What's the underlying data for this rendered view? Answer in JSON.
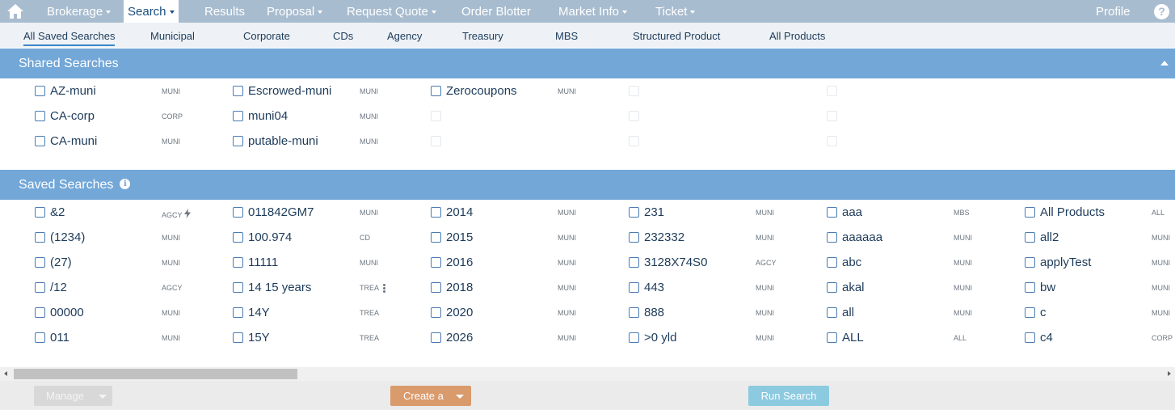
{
  "nav": {
    "items": [
      {
        "label": "Brokerage",
        "dropdown": true
      },
      {
        "label": "Search",
        "dropdown": true,
        "active": true
      },
      {
        "label": "Results",
        "dropdown": false
      },
      {
        "label": "Proposal",
        "dropdown": true
      },
      {
        "label": "Request Quote",
        "dropdown": true
      },
      {
        "label": "Order Blotter",
        "dropdown": false
      },
      {
        "label": "Market Info",
        "dropdown": true
      },
      {
        "label": "Ticket",
        "dropdown": true
      }
    ],
    "profile": "Profile",
    "help": "?"
  },
  "subnav": {
    "tabs": [
      "All Saved Searches",
      "Municipal",
      "Corporate",
      "CDs",
      "Agency",
      "Treasury",
      "MBS",
      "Structured Product",
      "All Products"
    ],
    "active": "All Saved Searches"
  },
  "shared": {
    "title": "Shared Searches",
    "rows": [
      [
        {
          "label": "AZ-muni",
          "type": "MUNI"
        },
        {
          "label": "Escrowed-muni",
          "type": "MUNI"
        },
        {
          "label": "Zerocoupons",
          "type": "MUNI"
        }
      ],
      [
        {
          "label": "CA-corp",
          "type": "CORP"
        },
        {
          "label": "muni04",
          "type": "MUNI"
        }
      ],
      [
        {
          "label": "CA-muni",
          "type": "MUNI"
        },
        {
          "label": "putable-muni",
          "type": "MUNI"
        }
      ]
    ]
  },
  "saved": {
    "title": "Saved Searches",
    "info_icon": "i",
    "rows": [
      [
        {
          "label": "&2",
          "type": "AGCY",
          "icon": "lightning-bolt-icon"
        },
        {
          "label": "011842GM7",
          "type": "MUNI"
        },
        {
          "label": "2014",
          "type": "MUNI"
        },
        {
          "label": "231",
          "type": "MUNI"
        },
        {
          "label": "aaa",
          "type": "MBS"
        },
        {
          "label": "All Products",
          "type": "ALL"
        }
      ],
      [
        {
          "label": "(1234)",
          "type": "MUNI"
        },
        {
          "label": "100.974",
          "type": "CD"
        },
        {
          "label": "2015",
          "type": "MUNI"
        },
        {
          "label": "232332",
          "type": "MUNI"
        },
        {
          "label": "aaaaaa",
          "type": "MUNI"
        },
        {
          "label": "all2",
          "type": "MUNI"
        }
      ],
      [
        {
          "label": "(27)",
          "type": "MUNI"
        },
        {
          "label": "11111",
          "type": "MUNI"
        },
        {
          "label": "2016",
          "type": "MUNI"
        },
        {
          "label": "3128X74S0",
          "type": "AGCY"
        },
        {
          "label": "abc",
          "type": "MUNI"
        },
        {
          "label": "applyTest",
          "type": "MUNI"
        }
      ],
      [
        {
          "label": "/12",
          "type": "AGCY"
        },
        {
          "label": "14 15 years",
          "type": "TREA",
          "icon": "more-vertical-icon"
        },
        {
          "label": "2018",
          "type": "MUNI"
        },
        {
          "label": "443",
          "type": "MUNI"
        },
        {
          "label": "akal",
          "type": "MUNI"
        },
        {
          "label": "bw",
          "type": "MUNI"
        }
      ],
      [
        {
          "label": "00000",
          "type": "MUNI"
        },
        {
          "label": "14Y",
          "type": "TREA"
        },
        {
          "label": "2020",
          "type": "MUNI"
        },
        {
          "label": "888",
          "type": "MUNI"
        },
        {
          "label": "all",
          "type": "MUNI"
        },
        {
          "label": "c",
          "type": "MUNI"
        }
      ],
      [
        {
          "label": "011",
          "type": "MUNI"
        },
        {
          "label": "15Y",
          "type": "TREA"
        },
        {
          "label": "2026",
          "type": "MUNI"
        },
        {
          "label": ">0 yld",
          "type": "MUNI"
        },
        {
          "label": "ALL",
          "type": "ALL"
        },
        {
          "label": "c4",
          "type": "CORP"
        }
      ]
    ]
  },
  "footer": {
    "manage": "Manage",
    "create": "Create a",
    "run": "Run Search"
  },
  "colors": {
    "nav_bg": "#a8bccf",
    "section_header": "#72a7d8",
    "text_dark": "#1d3b5a",
    "create_button": "#d99a6c",
    "run_button": "#8ccae0"
  }
}
